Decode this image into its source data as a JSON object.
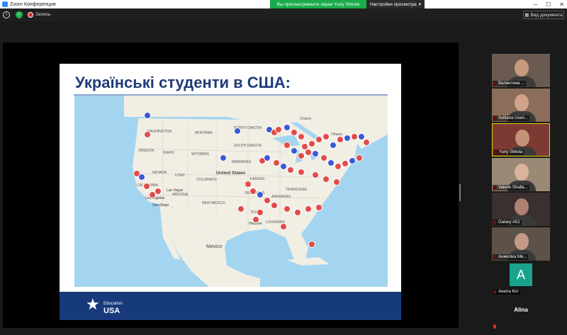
{
  "titlebar": {
    "app_title": "Zoom Конференция"
  },
  "share_banner": {
    "viewing_text": "Вы просматриваете экран Yuriy Shkola",
    "view_options": "Настройки просмотра"
  },
  "toolbar": {
    "recording_label": "Запись",
    "view_label": "Вид документа"
  },
  "slide": {
    "title": "Українські студенти в США:",
    "map_labels": {
      "washington": "WASHINGTON",
      "oregon": "OREGON",
      "idaho": "IDAHO",
      "montana": "MONTANA",
      "wyoming": "WYOMING",
      "nevada": "NEVADA",
      "utah": "UTAH",
      "colorado": "COLORADO",
      "united_states": "United States",
      "california": "CALIFORNIA",
      "arizona": "ARIZONA",
      "new_mexico": "NEW MEXICO",
      "north_dakota": "NORTH DAKOTA",
      "south_dakota": "SOUTH DAKOTA",
      "nebraska": "NEBRASKA",
      "kansas": "KANSAS",
      "oklahoma": "OKLAHOMA",
      "texas": "TEXAS",
      "arkansas": "ARKANSAS",
      "tennessee": "TENNESSEE",
      "louisiana": "LOUISIANA",
      "ontario": "Ontario",
      "ottawa": "Ottawa",
      "los_angeles": "Los Angeles",
      "las_vegas": "Las Vegas",
      "san_diego": "San Diego",
      "mexico": "Mexico",
      "houston": "Houston"
    },
    "logo_top": "Education",
    "logo_bottom": "USA"
  },
  "participants": [
    {
      "name": "Валентина ...",
      "skin": "#c89a80",
      "bg": "#6b5a4f"
    },
    {
      "name": "Svitlana Usen...",
      "skin": "#d0a38a",
      "bg": "#8a6d5a"
    },
    {
      "name": "Yuriy Shkola",
      "skin": "#c59178",
      "bg": "#7d3a33"
    },
    {
      "name": "Valerie Shalla...",
      "skin": "#d9b39a",
      "bg": "#9a8a75"
    },
    {
      "name": "Galaxy A51",
      "skin": "#b08070",
      "bg": "#3a3030"
    },
    {
      "name": "Анжеліка Ми...",
      "skin": "#c49a85",
      "bg": "#5c5248"
    },
    {
      "name": "Анюта Кот",
      "avatar_letter": "A",
      "avatar_color": "#1aa38b"
    },
    {
      "name": "Alina"
    }
  ],
  "colors": {
    "zoom_green": "#1aab4b",
    "slide_navy": "#1f3b78",
    "pin_red": "#e34b4b",
    "pin_blue": "#3b5bd6",
    "ocean": "#a3d5f0",
    "land": "#f1eee4"
  }
}
